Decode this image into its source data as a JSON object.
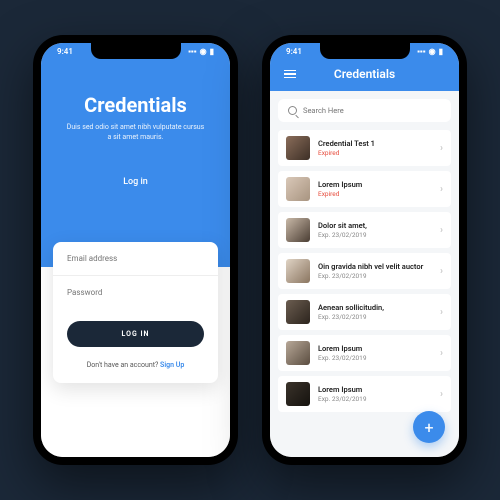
{
  "status": {
    "time": "9:41",
    "signal": "▪▪▪",
    "wifi": "◉",
    "battery": "▮"
  },
  "login": {
    "title": "Credentials",
    "subtitle": "Duis sed odio sit amet nibh vulputate cursus a sit amet mauris.",
    "tab_label": "Log in",
    "email_placeholder": "Email address",
    "password_placeholder": "Password",
    "button": "LOG IN",
    "signup_prompt": "Don't have an account? ",
    "signup_link": "Sign Up"
  },
  "list": {
    "header": "Credentials",
    "search_placeholder": "Search Here",
    "fab": "+",
    "items": [
      {
        "title": "Credential Test 1",
        "sub": "Expired",
        "status": "expired"
      },
      {
        "title": "Lorem Ipsum",
        "sub": "Expired",
        "status": "expired"
      },
      {
        "title": "Dolor sit amet,",
        "sub": "Exp. 23/02/2019",
        "status": "normal"
      },
      {
        "title": "Oin gravida nibh vel velit auctor",
        "sub": "Exp. 23/02/2019",
        "status": "normal"
      },
      {
        "title": "Aenean sollicitudin,",
        "sub": "Exp. 23/02/2019",
        "status": "normal"
      },
      {
        "title": "Lorem Ipsum",
        "sub": "Exp. 23/02/2019",
        "status": "normal"
      },
      {
        "title": "Lorem Ipsum",
        "sub": "Exp. 23/02/2019",
        "status": "normal"
      }
    ]
  }
}
